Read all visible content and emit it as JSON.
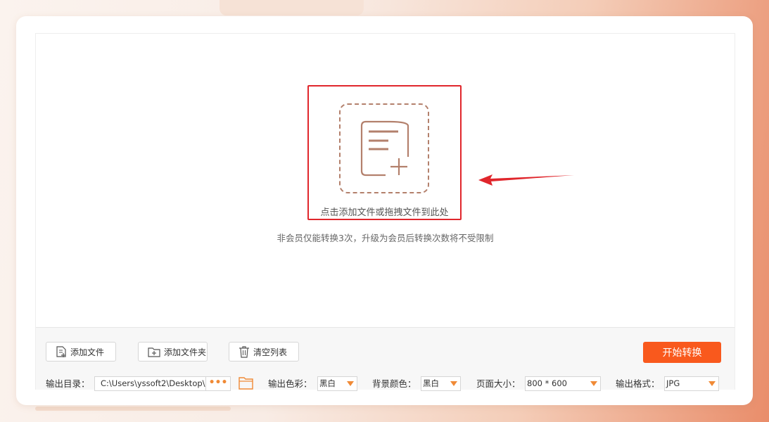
{
  "drop_zone": {
    "prompt": "点击添加文件或拖拽文件到此处",
    "notice": "非会员仅能转换3次，升级为会员后转换次数将不受限制"
  },
  "toolbar": {
    "add_file": "添加文件",
    "add_folder": "添加文件夹",
    "clear_list": "清空列表",
    "start": "开始转换"
  },
  "settings": {
    "output_dir_label": "输出目录：",
    "output_dir_value": "C:\\Users\\yssoft2\\Desktop\\",
    "browse_dots": "•••",
    "color_label": "输出色彩：",
    "color_value": "黑白",
    "bg_label": "背景颜色：",
    "bg_value": "黑白",
    "page_size_label": "页面大小：",
    "page_size_value": "800 * 600",
    "format_label": "输出格式：",
    "format_value": "JPG"
  },
  "colors": {
    "accent": "#f9591d",
    "icon_brown": "#b3806c",
    "highlight_red": "#e0262c",
    "folder_orange": "#f08a36"
  },
  "icons": [
    "document-add-icon",
    "arrow-icon",
    "add-file-icon",
    "add-folder-icon",
    "trash-icon",
    "folder-icon",
    "dropdown-caret-icon"
  ]
}
